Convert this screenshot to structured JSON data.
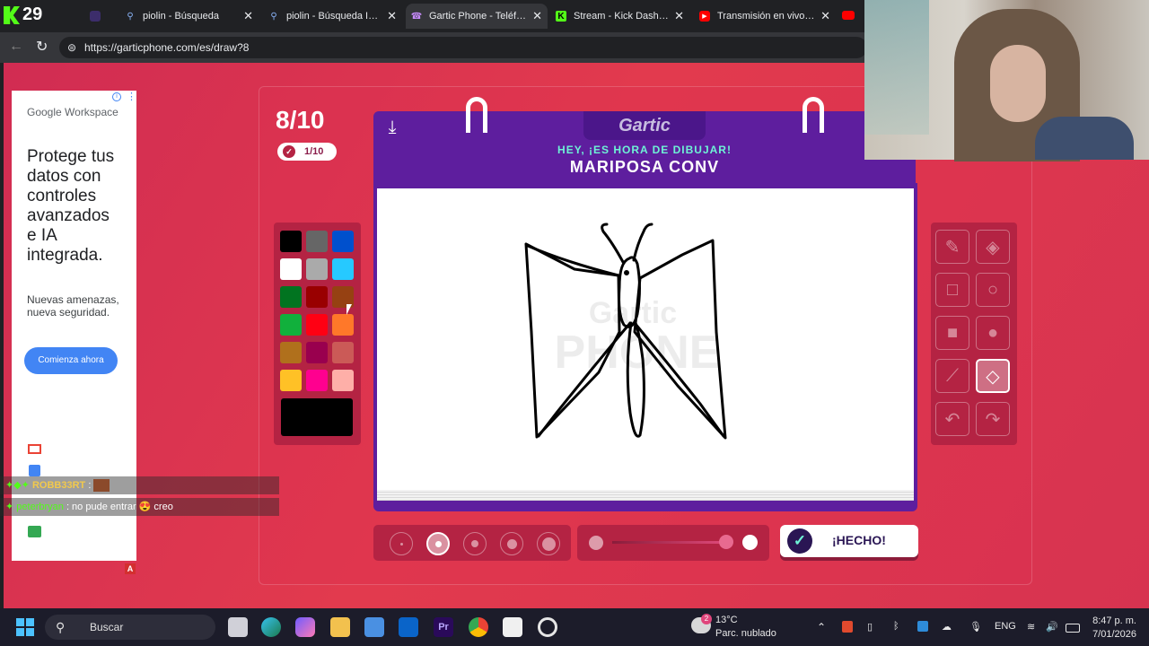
{
  "browser": {
    "kick_counter": "29",
    "tabs": [
      {
        "label": "piolin - Búsqueda",
        "favicon": "search-icon",
        "color": "#8ab4f8"
      },
      {
        "label": "piolin - Búsqueda Imág",
        "favicon": "search-icon",
        "color": "#8ab4f8"
      },
      {
        "label": "Gartic Phone - Teléfono",
        "favicon": "phone-icon",
        "color": "#c58af9",
        "active": true
      },
      {
        "label": "Stream - Kick Dashboar",
        "favicon": "kick-icon",
        "color": "#53fc18"
      },
      {
        "label": "Transmisión en vivo - Yo",
        "favicon": "youtube-icon",
        "color": "#ff0000"
      }
    ],
    "url": "https://garticphone.com/es/draw?8"
  },
  "ad": {
    "brand": "Google Workspace",
    "headline": [
      "Protege tus",
      "datos con",
      "controles",
      "avanzados",
      "e IA",
      "integrada."
    ],
    "body": [
      "Nuevas amenazas,",
      "nueva seguridad."
    ],
    "cta": "Comienza ahora"
  },
  "game": {
    "round": "8/10",
    "sub_counter": "1/10",
    "logo": "Gartic",
    "prompt_hint": "HEY, ¡ES HORA DE DIBUJAR!",
    "word": "MARIPOSA CONV",
    "done_label": "¡HECHO!",
    "palette": [
      "#000000",
      "#666666",
      "#0050cd",
      "#ffffff",
      "#aaaaaa",
      "#26c9ff",
      "#017420",
      "#990000",
      "#964112",
      "#11b03c",
      "#ff0013",
      "#ff7829",
      "#b0701c",
      "#99004e",
      "#cb5a57",
      "#ffc126",
      "#ff008f",
      "#feafa8"
    ],
    "current_color": "#000000",
    "tools": [
      "pencil-icon",
      "eraser-icon",
      "rectangle-outline-icon",
      "circle-outline-icon",
      "rectangle-fill-icon",
      "circle-fill-icon",
      "line-icon",
      "bucket-icon",
      "undo-icon",
      "redo-icon"
    ],
    "selected_tool": "bucket-icon",
    "brush_size_selected": 2,
    "opacity": 1
  },
  "chat": [
    {
      "user": "ROBB33RT",
      "message": ":"
    },
    {
      "user": "peterbryan",
      "message": ": no pude entrar 😍 creo"
    }
  ],
  "taskbar": {
    "search": "Buscar",
    "weather_temp": "13°C",
    "weather_desc": "Parc. nublado",
    "weather_badge": "2",
    "lang": "ENG",
    "time": "8:47 p. m.",
    "date": "7/01/2026"
  }
}
